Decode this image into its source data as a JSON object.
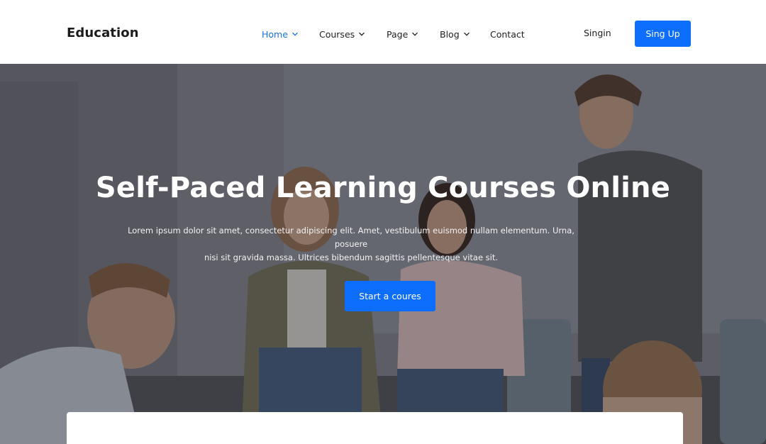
{
  "brand": {
    "name": "Education"
  },
  "nav": {
    "items": [
      {
        "label": "Home",
        "active": true,
        "has_dropdown": true
      },
      {
        "label": "Courses",
        "active": false,
        "has_dropdown": true
      },
      {
        "label": "Page",
        "active": false,
        "has_dropdown": true
      },
      {
        "label": "Blog",
        "active": false,
        "has_dropdown": true
      },
      {
        "label": "Contact",
        "active": false,
        "has_dropdown": false
      }
    ],
    "signin_label": "Singin",
    "signup_label": "Sing Up"
  },
  "hero": {
    "title": "Self-Paced Learning Courses Online",
    "description_line1": "Lorem ipsum dolor sit amet, consectetur adipiscing elit. Amet, vestibulum euismod nullam elementum. Urna, posuere",
    "description_line2": "nisi sit gravida massa. Ultrices bibendum sagittis pellentesque vitae sit.",
    "cta_label": "Start a coures"
  },
  "colors": {
    "accent": "#0d6efd",
    "active_nav": "#1a73e8",
    "text_dark": "#1b1b1b",
    "white": "#ffffff"
  },
  "icons": {
    "dropdown": "chevron-down-icon"
  }
}
